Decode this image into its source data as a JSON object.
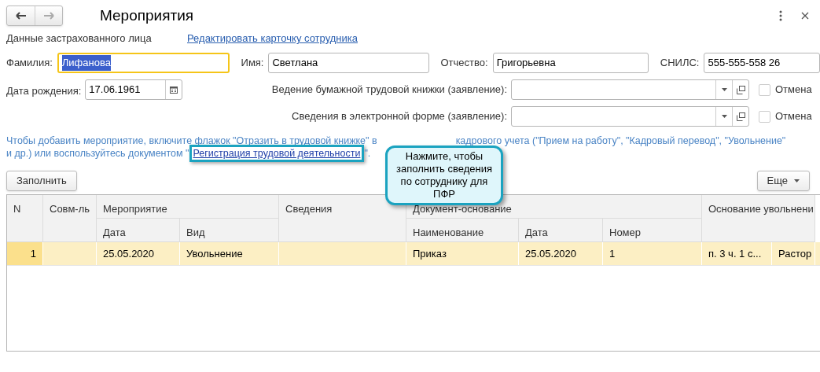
{
  "window": {
    "title": "Мероприятия"
  },
  "nav": [
    {
      "kind": "back",
      "disabled": false
    },
    {
      "kind": "forward",
      "disabled": true
    }
  ],
  "section_label": "Данные застрахованного лица",
  "edit_link": "Редактировать карточку сотрудника",
  "fields": [
    {
      "label": "Фамилия:",
      "value": "Лифанова",
      "focused": true
    },
    {
      "label": "Имя:",
      "value": "Светлана",
      "focused": false
    },
    {
      "label": "Отчество:",
      "value": "Григорьевна",
      "focused": false
    },
    {
      "label": "СНИЛС:",
      "value": "555-555-558 26",
      "focused": false
    }
  ],
  "birth_date": {
    "label": "Дата рождения:",
    "value": "17.06.1961"
  },
  "statements": [
    {
      "label": "Ведение бумажной трудовой книжки (заявление):",
      "cancel_label": "Отмена",
      "cancel_checked": false
    },
    {
      "label": "Сведения в электронной форме (заявление):",
      "cancel_label": "Отмена",
      "cancel_checked": false
    }
  ],
  "info": {
    "line1_start": "Чтобы добавить мероприятие, включите флажок \"Отразить в трудовой книжке\" в",
    "line1_end": "кадрового учета (\"Прием на работу\", \"Кадровый перевод\", \"Увольнение\"",
    "line2_start": "и др.) или воспользуйтесь документом \"",
    "link": "Регистрация трудовой деятельности",
    "line2_end": "\"."
  },
  "callout": "Нажмите, чтобы заполнить сведения по сотруднику для ПФР",
  "toolbar": {
    "fill_button": "Заполнить",
    "more_button": "Еще"
  },
  "table": {
    "columns": [
      {
        "label": "N"
      },
      {
        "label": "Совм-ль"
      },
      {
        "label": "Мероприятие",
        "children": [
          "Дата",
          "Вид"
        ]
      },
      {
        "label": "Сведения"
      },
      {
        "label": "Документ-основание",
        "children": [
          "Наименование",
          "Дата",
          "Номер"
        ]
      },
      {
        "label": "Основание увольнени"
      }
    ],
    "rows": [
      {
        "selected": true,
        "cells": [
          "1",
          null,
          [
            "25.05.2020",
            "Увольнение"
          ],
          null,
          [
            "Приказ",
            "25.05.2020",
            "1"
          ],
          [
            "п. 3 ч. 1 с...",
            "Растор"
          ]
        ]
      }
    ]
  }
}
